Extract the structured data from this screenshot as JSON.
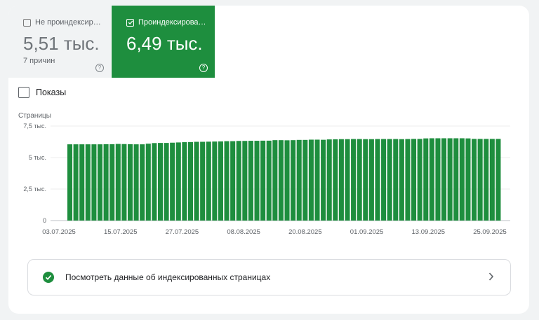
{
  "tabs": {
    "not_indexed": {
      "label": "Не проиндексир…",
      "value": "5,51 тыс.",
      "sub": "7 причин",
      "selected": false
    },
    "indexed": {
      "label": "Проиндексирова…",
      "value": "6,49 тыс.",
      "selected": true
    }
  },
  "shows_label": "Показы",
  "footer": {
    "text": "Посмотреть данные об индексированных страницах"
  },
  "colors": {
    "accent": "#1e8e3e",
    "gray_tab": "#f1f3f4"
  },
  "icons": {
    "help": "help-circle-icon",
    "check": "check-circle-icon",
    "chevron": "chevron-right-icon"
  },
  "chart_data": {
    "type": "bar",
    "ylabel": "Страницы",
    "ylim": [
      0,
      7500
    ],
    "yticks": [
      0,
      2500,
      5000,
      7500
    ],
    "ytick_labels": [
      "0",
      "2,5 тыс.",
      "5 тыс.",
      "7,5 тыс."
    ],
    "xtick_labels": [
      "03.07.2025",
      "15.07.2025",
      "27.07.2025",
      "08.08.2025",
      "20.08.2025",
      "01.09.2025",
      "13.09.2025",
      "25.09.2025"
    ],
    "grid": true,
    "series": [
      {
        "values": [
          6050,
          6050,
          6050,
          6050,
          6050,
          6050,
          6060,
          6060,
          6080,
          6070,
          6060,
          6050,
          6050,
          6100,
          6150,
          6160,
          6160,
          6180,
          6200,
          6220,
          6230,
          6250,
          6250,
          6260,
          6270,
          6280,
          6300,
          6300,
          6320,
          6320,
          6330,
          6330,
          6340,
          6340,
          6380,
          6380,
          6370,
          6380,
          6400,
          6400,
          6420,
          6420,
          6410,
          6440,
          6450,
          6460,
          6460,
          6470,
          6470,
          6460,
          6460,
          6470,
          6470,
          6470,
          6470,
          6460,
          6470,
          6480,
          6480,
          6520,
          6530,
          6530,
          6530,
          6530,
          6530,
          6530,
          6520,
          6480,
          6480,
          6480,
          6480,
          6480
        ]
      }
    ]
  }
}
